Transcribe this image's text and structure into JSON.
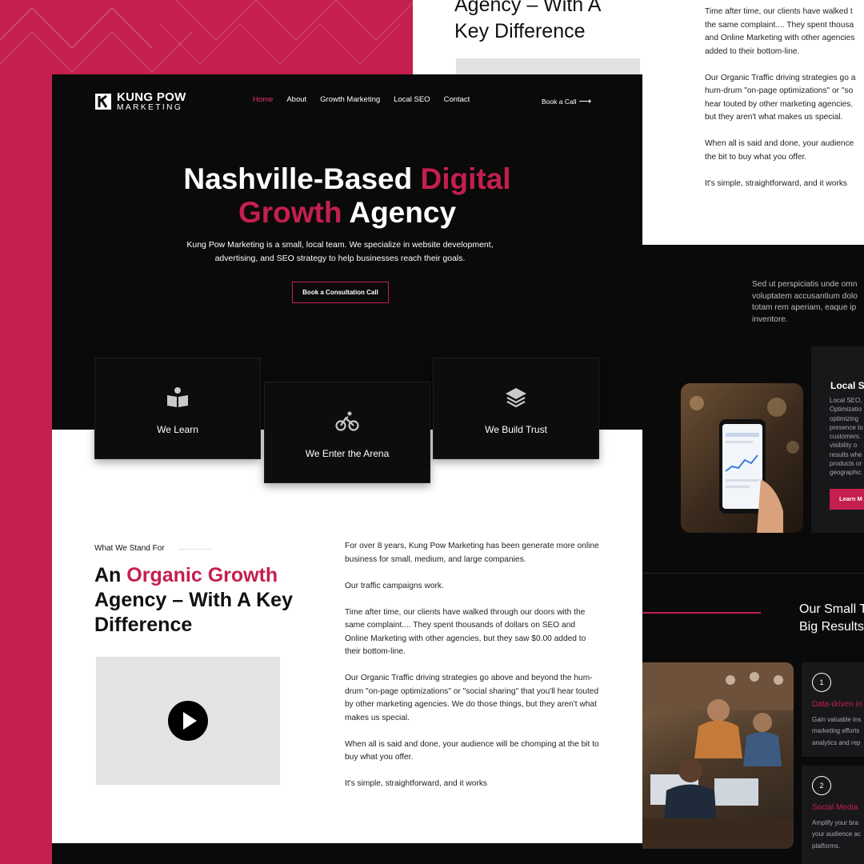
{
  "brand": {
    "name_line1": "KUNG POW",
    "name_line2": "MARKETING",
    "accent": "#c41f4e",
    "dark": "#0a0a0b"
  },
  "nav": {
    "items": [
      "Home",
      "About",
      "Growth Marketing",
      "Local SEO",
      "Contact"
    ],
    "active": "Home",
    "book_call": "Book a Call"
  },
  "hero": {
    "title_part1": "Nashville-Based ",
    "title_accent1": "Digital",
    "title_accent2": "Growth",
    "title_part2": " Agency",
    "subtitle": "Kung Pow Marketing is a small, local team. We specialize in website development, advertising, and SEO strategy to help businesses reach their goals.",
    "cta": "Book a Consultation Call"
  },
  "cards": [
    {
      "label": "We Learn",
      "icon": "book-reader-icon"
    },
    {
      "label": "We Enter the Arena",
      "icon": "bicycle-icon"
    },
    {
      "label": "We Build Trust",
      "icon": "layers-icon"
    }
  ],
  "stand_for": {
    "label": "What We Stand For",
    "title_part1": "An ",
    "title_accent": "Organic Growth",
    "title_part2": "Agency – With A Key Difference",
    "play_icon": "play-icon"
  },
  "body": {
    "p1": "For over 8 years, Kung Pow Marketing has been generate more online business for small, medium, and large companies.",
    "p2": "Our traffic campaigns work.",
    "p3": "Time after time, our clients have walked through our doors with the same complaint.... They spent thousands of dollars on SEO and Online Marketing with other agencies, but they saw $0.00 added to their bottom-line.",
    "p4": "Our Organic Traffic driving strategies go above and beyond the hum-drum \"on-page optimizations\" or \"social sharing\" that you'll hear touted by other marketing agencies. We do those things, but they aren't what makes us special.",
    "p5": "When all is said and done, your audience will be chomping at the bit to buy what you offer.",
    "p6": "It's simple, straightforward, and it works"
  },
  "back_top": {
    "heading_l1": "Agency – With A",
    "heading_l2": "Key Difference",
    "lines": [
      [
        "Time after time, our clients have walked t",
        "the same complaint.... They spent thousa",
        "and Online Marketing with other agencies",
        "added to their bottom-line."
      ],
      [
        "Our Organic Traffic driving strategies go a",
        "hum-drum \"on-page optimizations\" or \"so",
        "hear touted by other marketing agencies.",
        "but they aren't what makes us special."
      ],
      [
        "When all is said and done, your audience",
        "the bit to buy what you offer."
      ],
      [
        "It's simple, straightforward, and it works"
      ]
    ]
  },
  "back_right": {
    "lorem": [
      "Sed ut perspiciatis unde omn",
      "voluptatem accusantium dolo",
      "totam rem aperiam, eaque ip",
      "inventore."
    ],
    "local": {
      "title": "Local S",
      "body": [
        "Local SEO,",
        "Optimizatio",
        "optimizing",
        "presence to",
        "customers.",
        "visibility o",
        "results whe",
        "products or",
        "geographic"
      ],
      "button": "Learn M"
    },
    "small_team_l1": "Our Small T",
    "small_team_l2": "Big Results",
    "features": [
      {
        "num": "1",
        "title": "Data-driven In",
        "body": [
          "Gain valuable ins",
          "marketing efforts",
          "analytics and rep"
        ]
      },
      {
        "num": "2",
        "title": "Social Media",
        "body": [
          "Amplify your bra",
          "your audience ac",
          "platforms."
        ]
      }
    ]
  }
}
